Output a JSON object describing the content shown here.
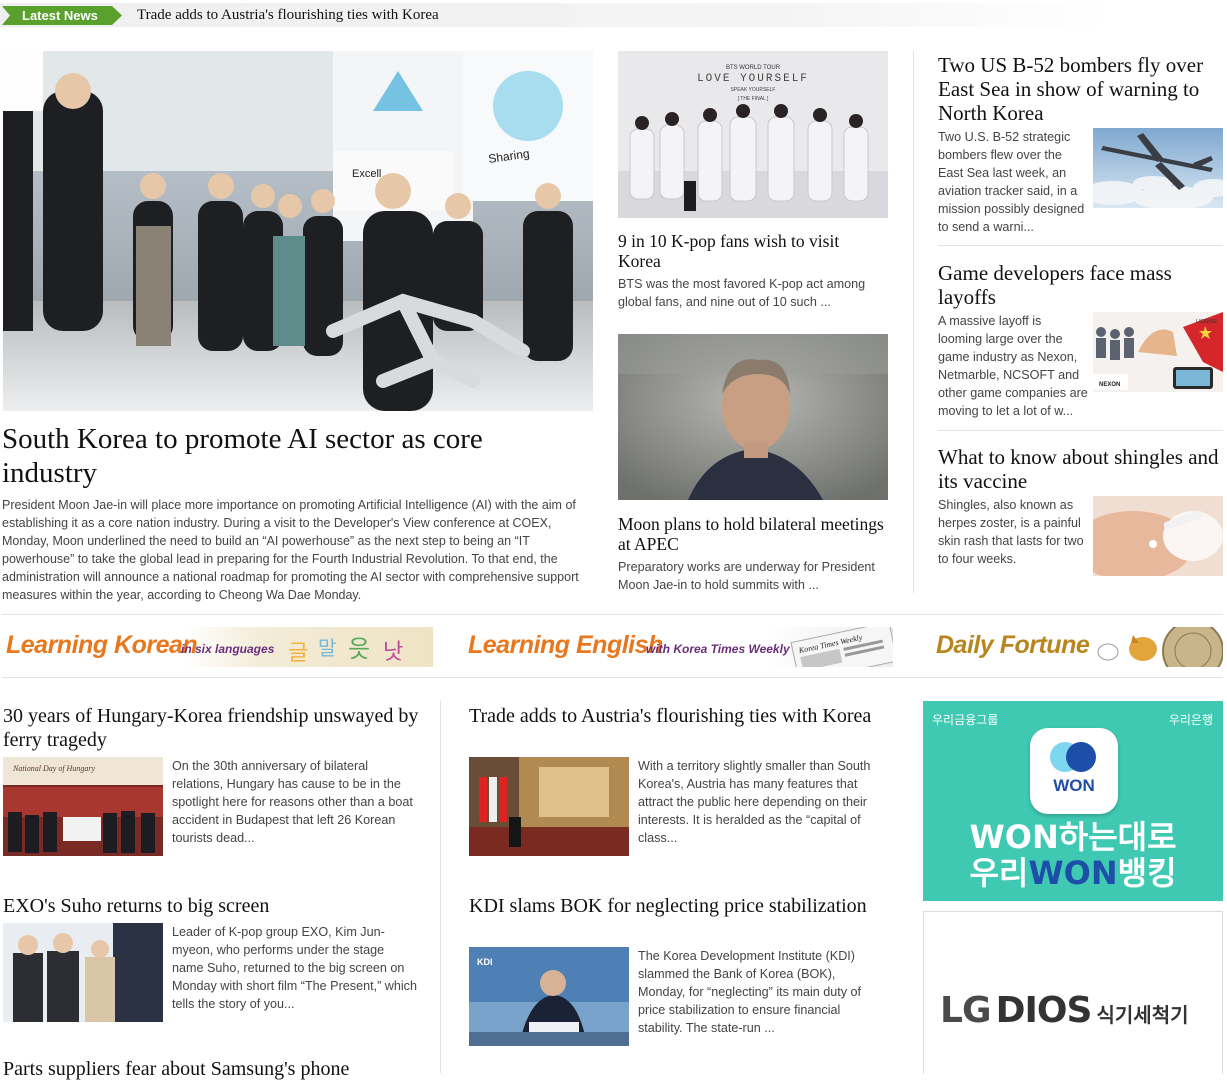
{
  "ticker": {
    "tag": "Latest News",
    "headline": "Trade adds to Austria's flourishing ties with Korea"
  },
  "lead": {
    "title": "South Korea to promote AI sector as core industry",
    "body": "President Moon Jae-in will place more importance on promoting Artificial Intelligence (AI) with the aim of establishing it as a core nation industry. During a visit to the Developer's View conference at COEX, Monday, Moon underlined the need to build an “AI powerhouse” as the next step to being an “IT powerhouse” to take the global lead in preparing for the Fourth Industrial Revolution. To that end, the administration will announce a national roadmap for promoting the AI sector with comprehensive support measures within the year, according to Cheong Wa Dae Monday.",
    "photo_signs": {
      "left": "Excell",
      "right": "Sharing"
    }
  },
  "middle": [
    {
      "title": "9 in 10 K-pop fans wish to visit Korea",
      "body": "BTS was the most favored K-pop act among global fans, and nine out of 10 such ...",
      "photo_text": {
        "l1": "BTS WORLD TOUR",
        "l2": "LOVE YOURSELF",
        "l3": "SPEAK YOURSELF",
        "l4": "[ THE FINAL ]"
      }
    },
    {
      "title": "Moon plans to hold bilateral meetings at APEC",
      "body": "Preparatory works are underway for President Moon Jae-in to hold summits with ..."
    }
  ],
  "right": [
    {
      "title": "Two US B-52 bombers fly over East Sea in show of warning to North Korea",
      "body": "Two U.S. B-52 strategic bombers flew over the East Sea last week, an aviation tracker said, in a mission possibly designed to send a warni..."
    },
    {
      "title": "Game developers face mass layoffs",
      "body": "A massive layoff is looming large over the game industry as Nexon, Netmarble, NCSOFT and other game companies are moving to let a lot of w...",
      "photo_text": {
        "license": "LICENSE",
        "nexon": "NEXON"
      }
    },
    {
      "title": "What to know about shingles and its vaccine",
      "body": "Shingles, also known as herpes zoster, is a painful skin rash that lasts for two to four weeks."
    }
  ],
  "banners": {
    "korean": {
      "title": "Learning Korean",
      "sub": "in six languages"
    },
    "english": {
      "title": "Learning English",
      "sub": "with Korea Times Weekly",
      "paper": "Korea Times Weekly"
    },
    "fortune": {
      "title": "Daily Fortune"
    }
  },
  "lower_left": [
    {
      "title": "30 years of Hungary-Korea friendship unswayed by ferry tragedy",
      "body": "On the 30th anniversary of bilateral relations, Hungary has cause to be in the spotlight here for reasons other than a boat accident in Budapest that left 26 Korean tourists dead...",
      "photo_text": "National Day of Hungary"
    },
    {
      "title": "EXO's Suho returns to big screen",
      "body": "Leader of K-pop group EXO, Kim Jun-myeon, who performs under the stage name Suho, returned to the big screen on Monday with short film “The Present,” which tells the story of you..."
    },
    {
      "title": "Parts suppliers fear about Samsung's phone"
    }
  ],
  "lower_mid": [
    {
      "title": "Trade adds to Austria's flourishing ties with Korea",
      "body": "With a territory slightly smaller than South Korea's, Austria has many features that attract the public here depending on their interests. It is heralded as the “capital of class..."
    },
    {
      "title": "KDI slams BOK for neglecting price stabilization",
      "body": "The Korea Development Institute (KDI) slammed the Bank of Korea (BOK), Monday, for “neglecting” its main duty of price stabilization to ensure financial stability. The state-run ...",
      "photo_text": "KDI"
    }
  ],
  "ads": {
    "woori": {
      "group": "우리금융그룹",
      "bank": "우리은행",
      "app": "WON",
      "line1": "WON하는대로",
      "line2_a": "우리",
      "line2_b": "WON",
      "line2_c": "뱅킹"
    },
    "lg": {
      "brand": "LG",
      "product": "DIOS",
      "kr": "식기세척기"
    }
  },
  "colors": {
    "tag_green": "#5aa02c",
    "banner_orange": "#e8781e",
    "banner_purple": "#6a2f7b",
    "fortune_gold": "#b8861e",
    "woori_teal": "#3fc9b3",
    "won_blue": "#1e4fa8"
  }
}
